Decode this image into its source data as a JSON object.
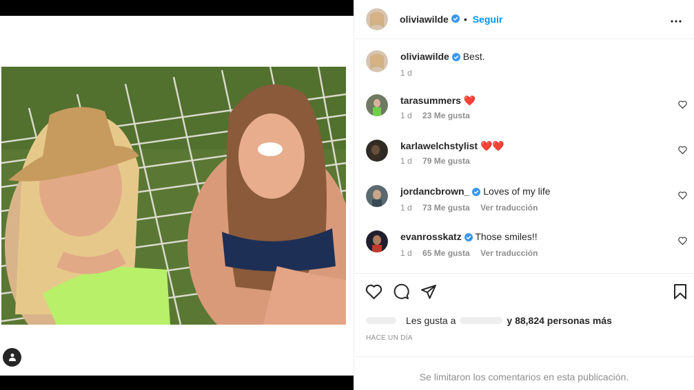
{
  "post": {
    "author": "oliviawilde",
    "follow_label": "Seguir",
    "dot": "•",
    "caption": "Best.",
    "caption_time": "1 d"
  },
  "comments": [
    {
      "user": "tarasummers",
      "verified": false,
      "text": "❤️",
      "time": "1 d",
      "likes": "23 Me gusta",
      "translate": ""
    },
    {
      "user": "karlawelchstylist",
      "verified": false,
      "text": "❤️❤️",
      "time": "1 d",
      "likes": "79 Me gusta",
      "translate": ""
    },
    {
      "user": "jordancbrown_",
      "verified": true,
      "text": "Loves of my life",
      "time": "1 d",
      "likes": "73 Me gusta",
      "translate": "Ver traducción"
    },
    {
      "user": "evanrosskatz",
      "verified": true,
      "text": "Those smiles!!",
      "time": "1 d",
      "likes": "65 Me gusta",
      "translate": "Ver traducción"
    }
  ],
  "likes": {
    "prefix": "Les gusta a",
    "suffix": "y 88,824 personas más"
  },
  "timestamp": "HACE UN DÍA",
  "comments_limited": "Se limitaron los comentarios en esta publicación.",
  "colors": {
    "accent": "#0095f6",
    "verified": "#3897f0",
    "heart": "#ed4956"
  },
  "icons": [
    "tagged-user-icon",
    "more-options-icon",
    "verified-badge-icon",
    "heart-icon",
    "comment-icon",
    "share-icon",
    "bookmark-icon"
  ]
}
